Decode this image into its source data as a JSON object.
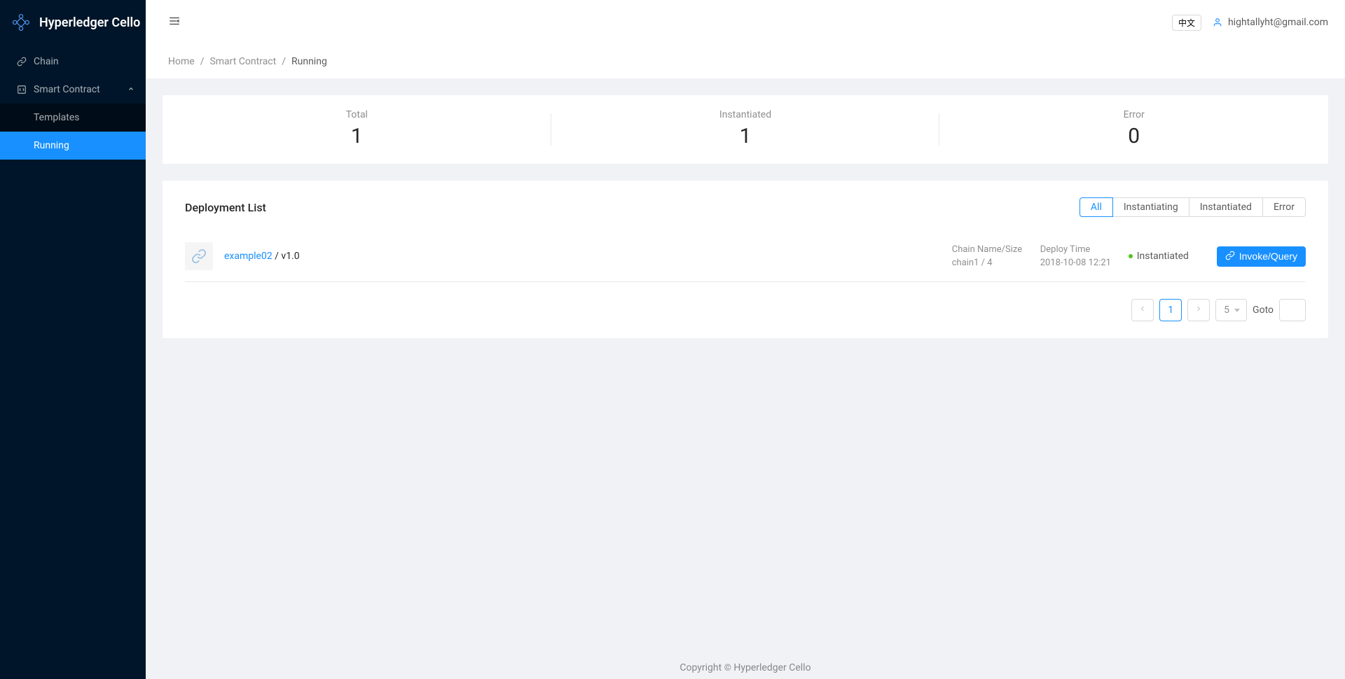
{
  "app": {
    "name": "Hyperledger Cello"
  },
  "sidebar": {
    "items": [
      {
        "label": "Chain"
      },
      {
        "label": "Smart Contract"
      },
      {
        "label": "Templates"
      },
      {
        "label": "Running"
      }
    ]
  },
  "header": {
    "lang_btn": "中文",
    "user_email": "hightallyht@gmail.com"
  },
  "breadcrumb": {
    "home": "Home",
    "section": "Smart Contract",
    "current": "Running"
  },
  "stats": {
    "total": {
      "title": "Total",
      "value": "1"
    },
    "instantiated": {
      "title": "Instantiated",
      "value": "1"
    },
    "error": {
      "title": "Error",
      "value": "0"
    }
  },
  "list": {
    "title": "Deployment List",
    "filters": {
      "all": "All",
      "instantiating": "Instantiating",
      "instantiated": "Instantiated",
      "error": "Error"
    },
    "items": [
      {
        "name": "example02",
        "version_text": " / v1.0",
        "chain_label": "Chain Name/Size",
        "chain_value": "chain1 / 4",
        "time_label": "Deploy Time",
        "time_value": "2018-10-08 12:21",
        "status_text": "Instantiated",
        "action_label": "Invoke/Query"
      }
    ]
  },
  "pagination": {
    "current": "1",
    "page_size": "5",
    "goto_label": "Goto"
  },
  "footer": {
    "prefix": "Copyright ",
    "suffix": " Hyperledger Cello"
  }
}
